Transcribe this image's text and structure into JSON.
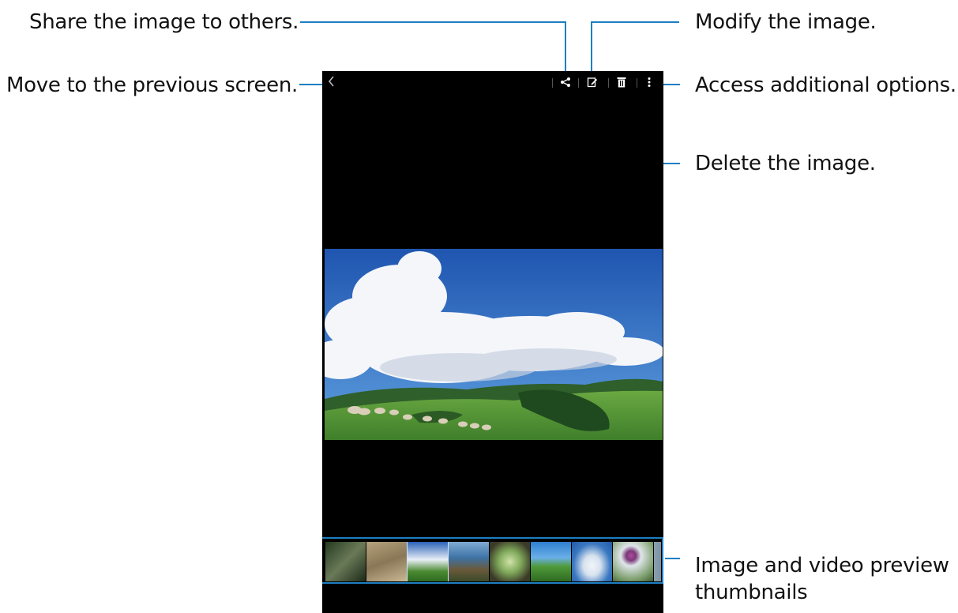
{
  "callouts": {
    "share": "Share the image to others.",
    "back": "Move to the previous screen.",
    "modify": "Modify the image.",
    "more": "Access additional options.",
    "delete": "Delete the image.",
    "thumbs_line1": "Image and video preview",
    "thumbs_line2": "thumbnails"
  },
  "actionbar": {
    "icons": [
      "back-icon",
      "share-icon",
      "edit-icon",
      "delete-icon",
      "more-options-icon"
    ]
  },
  "colors": {
    "callout_line": "#1d7fc2",
    "screen_bg": "#000000",
    "sky": "#2f6fc0",
    "grass": "#4f8f2f"
  },
  "thumbnails": [
    {
      "name": "forest-thumb"
    },
    {
      "name": "dry-grass-thumb"
    },
    {
      "name": "sky-hills-thumb"
    },
    {
      "name": "coast-cliff-thumb"
    },
    {
      "name": "succulent-thumb"
    },
    {
      "name": "tea-field-thumb"
    },
    {
      "name": "clouds-thumb"
    },
    {
      "name": "thistle-flower-thumb"
    }
  ]
}
